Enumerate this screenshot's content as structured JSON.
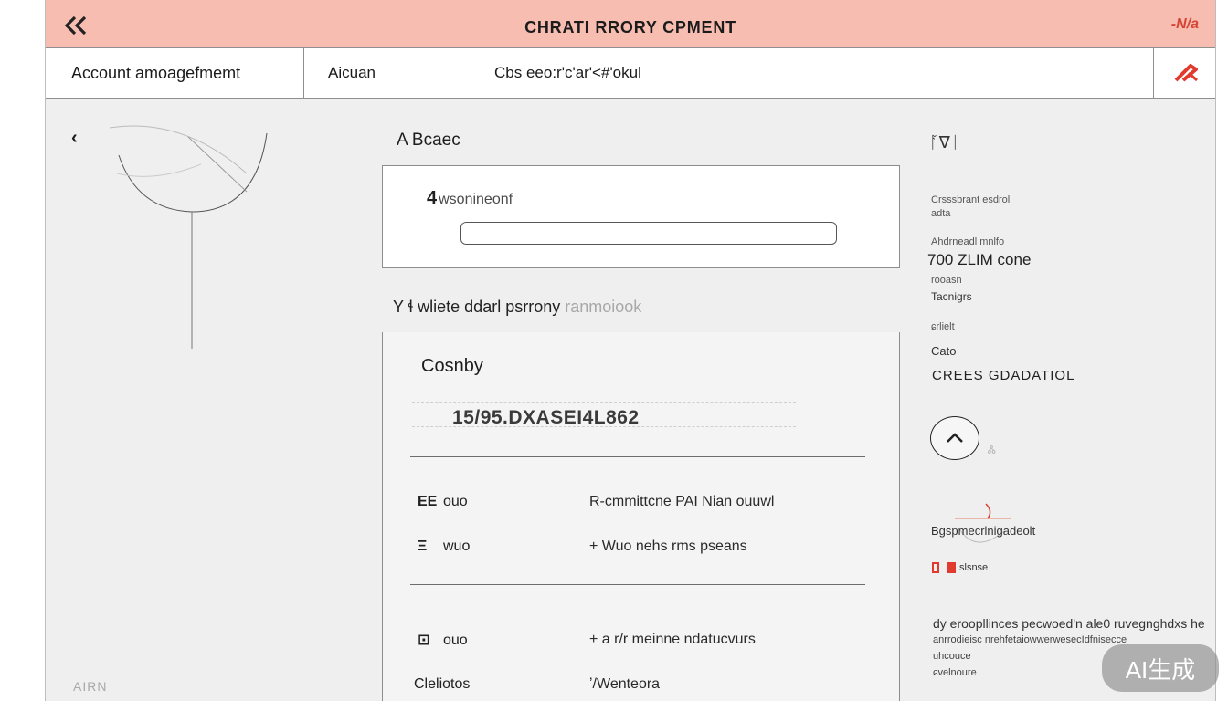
{
  "window": {
    "title": "CHRATI RRORY CPMENT",
    "brand_mark": "-N/a"
  },
  "tabs": [
    {
      "label": "Account amoagefmemt"
    },
    {
      "label": "Aicuan"
    },
    {
      "label": "Cbs eeo:r'c'ar'<#'okul"
    }
  ],
  "left": {
    "footer": "AIRN"
  },
  "main": {
    "section_title": "A Bcaec",
    "card_label_glyph": "4",
    "card_label": "wsonineonf",
    "card_input_value": "",
    "sub_prefix": "Y  ɬ  wliete ddarl psrrony",
    "sub_faint": "ranmoiook",
    "detail_label": "Cosnby",
    "code": "15/95.DXASEI4L862",
    "rows": [
      {
        "icon": "EE",
        "key": "ouo",
        "value": "R-cmmittcne PAI Nian ouuwl"
      },
      {
        "icon": "Ξ",
        "key": "wuo",
        "value": "+ Wuo nehs rms pseans"
      }
    ],
    "rows2": [
      {
        "icon": "⊡",
        "key": "ouo",
        "value": "+ a r/r meinne ndatucvurs"
      },
      {
        "icon": "",
        "key": "Cleliotos",
        "value": "ʼ/Wenteora"
      }
    ]
  },
  "right": {
    "sketch_text": "ᚪ∇ᛁ",
    "small_1": "Crsssbrant esdrol",
    "small_1b": "adta",
    "small_2": "Ahdrneadl mnlfo",
    "big": "700 ZLIM cone",
    "small_3": "rooasn",
    "small_4": "Tacnigrs",
    "small_5": "ɕrlielt",
    "small_6": "Cato",
    "caps": "CREES GDADATIOL",
    "circle_caption": "Ꮬ",
    "glyph_caption": "Bgspmecrlnigadeolt",
    "warn": "slsnse",
    "para": "dy eroopllinces pecwoed'n ale0 ruvegnghdxs he",
    "para_small": "anrrodieisc nrehfetaiowwerwesecIdfnisecce",
    "para_small2": "uhcouce",
    "para_small3": "ɕvelnoure"
  },
  "watermark": "AI生成",
  "colors": {
    "header_bg": "#f8bdb1",
    "accent_red": "#d54535",
    "panel_bg": "#efefef"
  },
  "icons": {
    "back": "double-chevron-left-icon",
    "tab_action": "red-pen-icon",
    "collapse": "chevron-left-icon",
    "circle": "chevron-up-icon"
  }
}
